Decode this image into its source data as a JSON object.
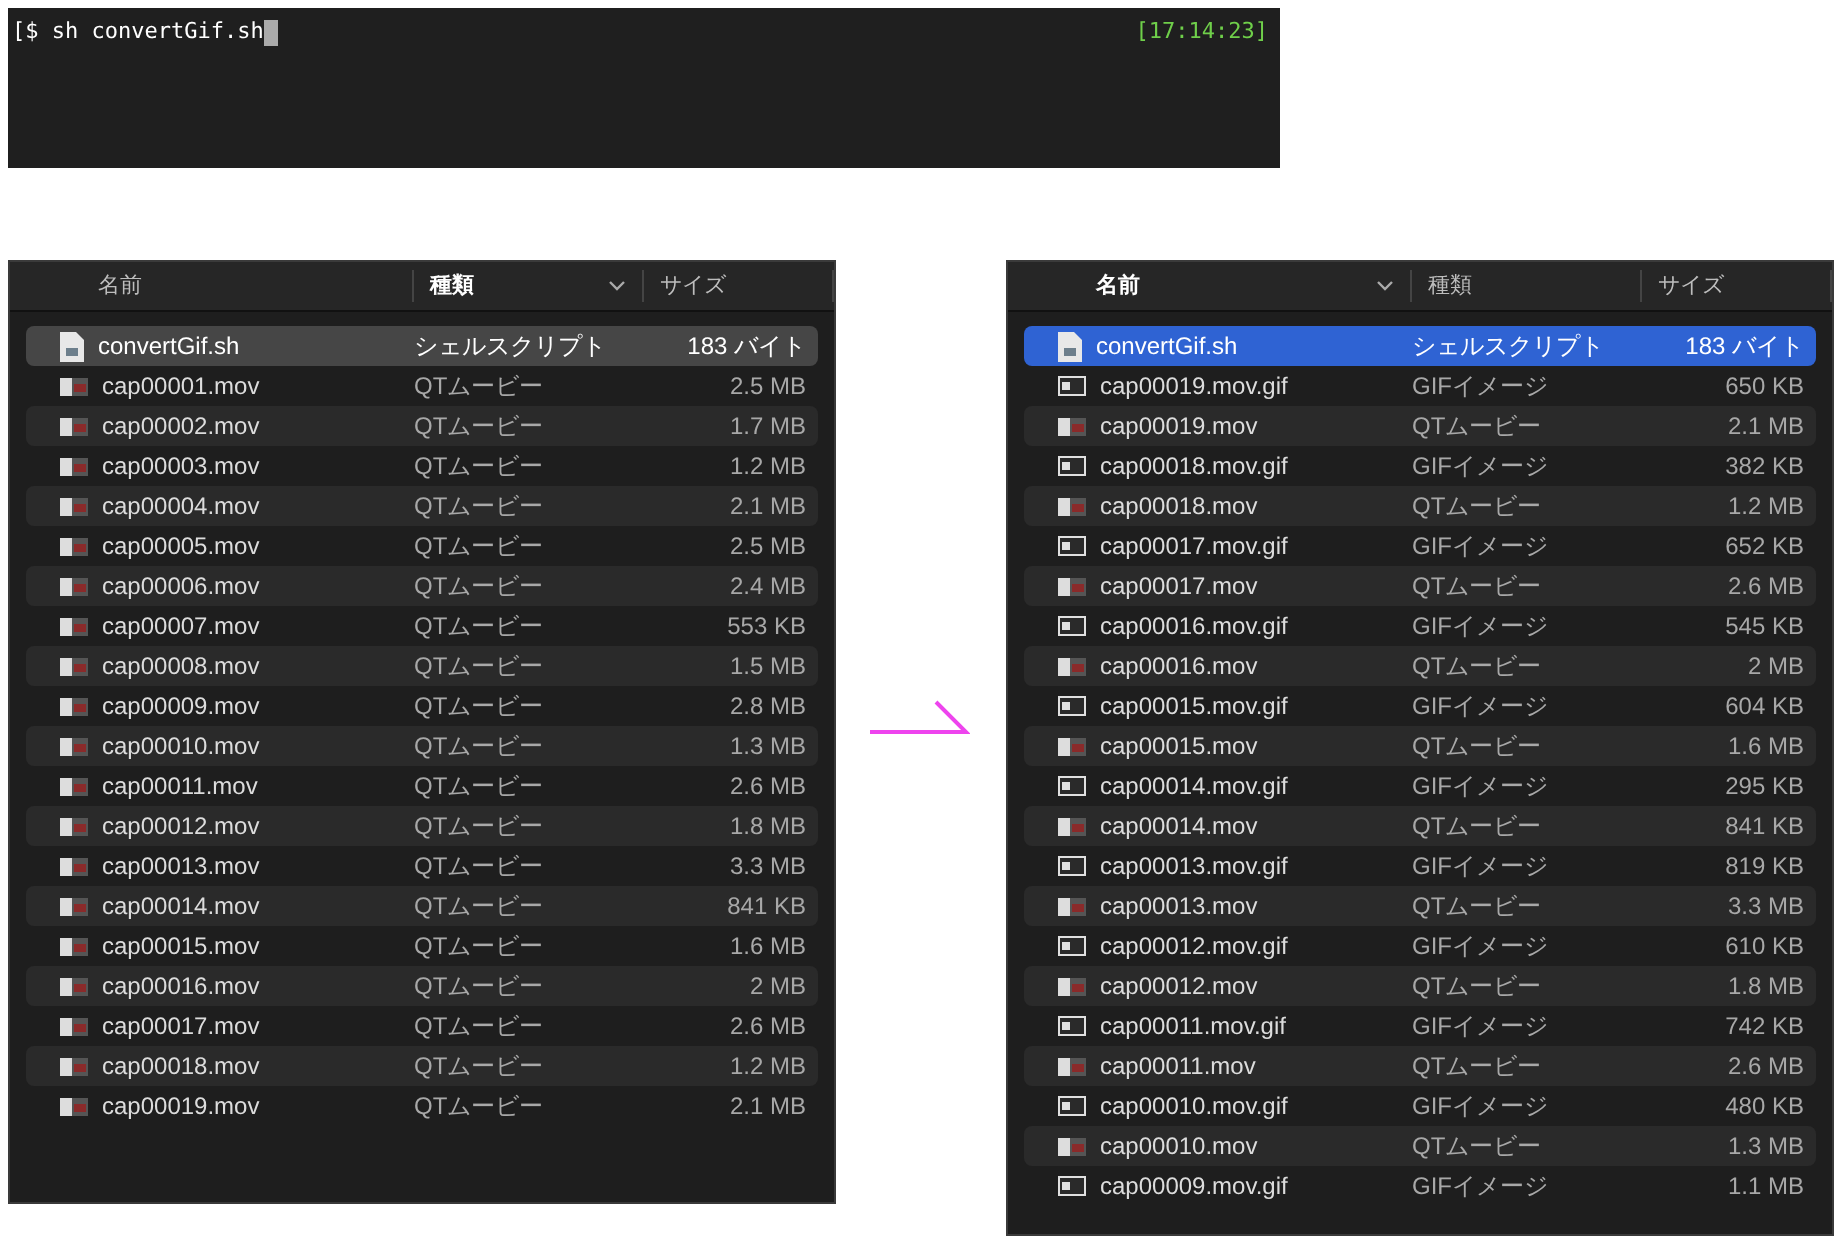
{
  "terminal": {
    "command": "[$ sh convertGif.sh",
    "time": "[17:14:23]"
  },
  "finder_before": {
    "focused": false,
    "columns": [
      {
        "label": "名前",
        "sorted": false
      },
      {
        "label": "種類",
        "sorted": true
      },
      {
        "label": "サイズ",
        "sorted": false
      }
    ],
    "rows": [
      {
        "kind": "script",
        "name": "convertGif.sh",
        "type": "シェルスクリプト",
        "size": "183 バイト",
        "selected": true
      },
      {
        "kind": "movie",
        "name": "cap00001.mov",
        "type": "QTムービー",
        "size": "2.5 MB",
        "selected": false
      },
      {
        "kind": "movie",
        "name": "cap00002.mov",
        "type": "QTムービー",
        "size": "1.7 MB",
        "selected": false
      },
      {
        "kind": "movie",
        "name": "cap00003.mov",
        "type": "QTムービー",
        "size": "1.2 MB",
        "selected": false
      },
      {
        "kind": "movie",
        "name": "cap00004.mov",
        "type": "QTムービー",
        "size": "2.1 MB",
        "selected": false
      },
      {
        "kind": "movie",
        "name": "cap00005.mov",
        "type": "QTムービー",
        "size": "2.5 MB",
        "selected": false
      },
      {
        "kind": "movie",
        "name": "cap00006.mov",
        "type": "QTムービー",
        "size": "2.4 MB",
        "selected": false
      },
      {
        "kind": "movie",
        "name": "cap00007.mov",
        "type": "QTムービー",
        "size": "553 KB",
        "selected": false
      },
      {
        "kind": "movie",
        "name": "cap00008.mov",
        "type": "QTムービー",
        "size": "1.5 MB",
        "selected": false
      },
      {
        "kind": "movie",
        "name": "cap00009.mov",
        "type": "QTムービー",
        "size": "2.8 MB",
        "selected": false
      },
      {
        "kind": "movie",
        "name": "cap00010.mov",
        "type": "QTムービー",
        "size": "1.3 MB",
        "selected": false
      },
      {
        "kind": "movie",
        "name": "cap00011.mov",
        "type": "QTムービー",
        "size": "2.6 MB",
        "selected": false
      },
      {
        "kind": "movie",
        "name": "cap00012.mov",
        "type": "QTムービー",
        "size": "1.8 MB",
        "selected": false
      },
      {
        "kind": "movie",
        "name": "cap00013.mov",
        "type": "QTムービー",
        "size": "3.3 MB",
        "selected": false
      },
      {
        "kind": "movie",
        "name": "cap00014.mov",
        "type": "QTムービー",
        "size": "841 KB",
        "selected": false
      },
      {
        "kind": "movie",
        "name": "cap00015.mov",
        "type": "QTムービー",
        "size": "1.6 MB",
        "selected": false
      },
      {
        "kind": "movie",
        "name": "cap00016.mov",
        "type": "QTムービー",
        "size": "2 MB",
        "selected": false
      },
      {
        "kind": "movie",
        "name": "cap00017.mov",
        "type": "QTムービー",
        "size": "2.6 MB",
        "selected": false
      },
      {
        "kind": "movie",
        "name": "cap00018.mov",
        "type": "QTムービー",
        "size": "1.2 MB",
        "selected": false
      },
      {
        "kind": "movie",
        "name": "cap00019.mov",
        "type": "QTムービー",
        "size": "2.1 MB",
        "selected": false
      }
    ]
  },
  "finder_after": {
    "focused": true,
    "columns": [
      {
        "label": "名前",
        "sorted": true
      },
      {
        "label": "種類",
        "sorted": false
      },
      {
        "label": "サイズ",
        "sorted": false
      }
    ],
    "rows": [
      {
        "kind": "script",
        "name": "convertGif.sh",
        "type": "シェルスクリプト",
        "size": "183 バイト",
        "selected": true
      },
      {
        "kind": "gif",
        "name": "cap00019.mov.gif",
        "type": "GIFイメージ",
        "size": "650 KB",
        "selected": false
      },
      {
        "kind": "movie",
        "name": "cap00019.mov",
        "type": "QTムービー",
        "size": "2.1 MB",
        "selected": false
      },
      {
        "kind": "gif",
        "name": "cap00018.mov.gif",
        "type": "GIFイメージ",
        "size": "382 KB",
        "selected": false
      },
      {
        "kind": "movie",
        "name": "cap00018.mov",
        "type": "QTムービー",
        "size": "1.2 MB",
        "selected": false
      },
      {
        "kind": "gif",
        "name": "cap00017.mov.gif",
        "type": "GIFイメージ",
        "size": "652 KB",
        "selected": false
      },
      {
        "kind": "movie",
        "name": "cap00017.mov",
        "type": "QTムービー",
        "size": "2.6 MB",
        "selected": false
      },
      {
        "kind": "gif",
        "name": "cap00016.mov.gif",
        "type": "GIFイメージ",
        "size": "545 KB",
        "selected": false
      },
      {
        "kind": "movie",
        "name": "cap00016.mov",
        "type": "QTムービー",
        "size": "2 MB",
        "selected": false
      },
      {
        "kind": "gif",
        "name": "cap00015.mov.gif",
        "type": "GIFイメージ",
        "size": "604 KB",
        "selected": false
      },
      {
        "kind": "movie",
        "name": "cap00015.mov",
        "type": "QTムービー",
        "size": "1.6 MB",
        "selected": false
      },
      {
        "kind": "gif",
        "name": "cap00014.mov.gif",
        "type": "GIFイメージ",
        "size": "295 KB",
        "selected": false
      },
      {
        "kind": "movie",
        "name": "cap00014.mov",
        "type": "QTムービー",
        "size": "841 KB",
        "selected": false
      },
      {
        "kind": "gif",
        "name": "cap00013.mov.gif",
        "type": "GIFイメージ",
        "size": "819 KB",
        "selected": false
      },
      {
        "kind": "movie",
        "name": "cap00013.mov",
        "type": "QTムービー",
        "size": "3.3 MB",
        "selected": false
      },
      {
        "kind": "gif",
        "name": "cap00012.mov.gif",
        "type": "GIFイメージ",
        "size": "610 KB",
        "selected": false
      },
      {
        "kind": "movie",
        "name": "cap00012.mov",
        "type": "QTムービー",
        "size": "1.8 MB",
        "selected": false
      },
      {
        "kind": "gif",
        "name": "cap00011.mov.gif",
        "type": "GIFイメージ",
        "size": "742 KB",
        "selected": false
      },
      {
        "kind": "movie",
        "name": "cap00011.mov",
        "type": "QTムービー",
        "size": "2.6 MB",
        "selected": false
      },
      {
        "kind": "gif",
        "name": "cap00010.mov.gif",
        "type": "GIFイメージ",
        "size": "480 KB",
        "selected": false
      },
      {
        "kind": "movie",
        "name": "cap00010.mov",
        "type": "QTムービー",
        "size": "1.3 MB",
        "selected": false
      },
      {
        "kind": "gif",
        "name": "cap00009.mov.gif",
        "type": "GIFイメージ",
        "size": "1.1 MB",
        "selected": false
      }
    ]
  }
}
